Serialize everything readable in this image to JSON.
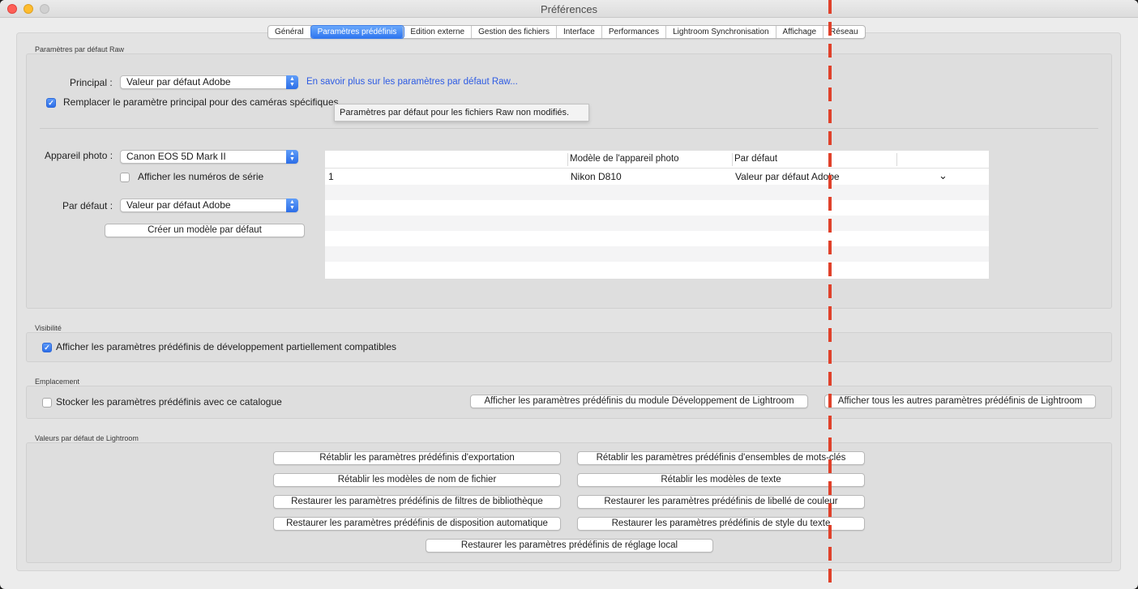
{
  "window": {
    "title": "Préférences"
  },
  "tabs": [
    {
      "label": "Général",
      "selected": false
    },
    {
      "label": "Paramètres prédéfinis",
      "selected": true
    },
    {
      "label": "Edition externe",
      "selected": false
    },
    {
      "label": "Gestion des fichiers",
      "selected": false
    },
    {
      "label": "Interface",
      "selected": false
    },
    {
      "label": "Performances",
      "selected": false
    },
    {
      "label": "Lightroom Synchronisation",
      "selected": false
    },
    {
      "label": "Affichage",
      "selected": false
    },
    {
      "label": "Réseau",
      "selected": false
    }
  ],
  "raw": {
    "section_label": "Paramètres par défaut Raw",
    "principal_label": "Principal :",
    "principal_value": "Valeur par défaut Adobe",
    "learn_more_link": "En savoir plus sur les paramètres par défaut Raw...",
    "override_checkbox_label": "Remplacer le paramètre principal pour des caméras spécifiques",
    "override_checked": true,
    "tooltip": "Paramètres par défaut pour les fichiers Raw non modifiés.",
    "camera_label": "Appareil photo :",
    "camera_value": "Canon EOS 5D Mark II",
    "serial_checkbox_label": "Afficher les numéros de série",
    "serial_checked": false,
    "default_label": "Par défaut :",
    "default_value": "Valeur par défaut Adobe",
    "create_button": "Créer un modèle par défaut",
    "table": {
      "headers": [
        "",
        "Modèle de l'appareil photo",
        "Par défaut",
        ""
      ],
      "rows": [
        {
          "index": "1",
          "model": "Nikon D810",
          "default": "Valeur par défaut Adobe",
          "chevron": "⌄"
        }
      ]
    }
  },
  "visibility": {
    "section_label": "Visibilité",
    "checkbox_label": "Afficher les paramètres prédéfinis de développement partiellement compatibles",
    "checked": true
  },
  "location": {
    "section_label": "Emplacement",
    "checkbox_label": "Stocker les paramètres prédéfinis avec ce catalogue",
    "checked": false,
    "show_develop_button": "Afficher les paramètres prédéfinis du module Développement de Lightroom",
    "show_all_button": "Afficher tous les autres paramètres prédéfinis de Lightroom"
  },
  "defaults": {
    "section_label": "Valeurs par défaut de Lightroom",
    "buttons": [
      "Rétablir les paramètres prédéfinis d'exportation",
      "Rétablir les paramètres prédéfinis d'ensembles de mots-clés",
      "Rétablir les modèles de nom de fichier",
      "Rétablir les modèles de texte",
      "Restaurer les paramètres prédéfinis de filtres de bibliothèque",
      "Restaurer les paramètres prédéfinis de libellé de couleur",
      "Restaurer les paramètres prédéfinis de disposition automatique",
      "Restaurer les paramètres prédéfinis de style du texte",
      "Restaurer les paramètres prédéfinis de réglage local"
    ]
  },
  "colors": {
    "accent": "#2f76f0",
    "link": "#2d5be3",
    "overlay_dash": "#e0412a"
  }
}
